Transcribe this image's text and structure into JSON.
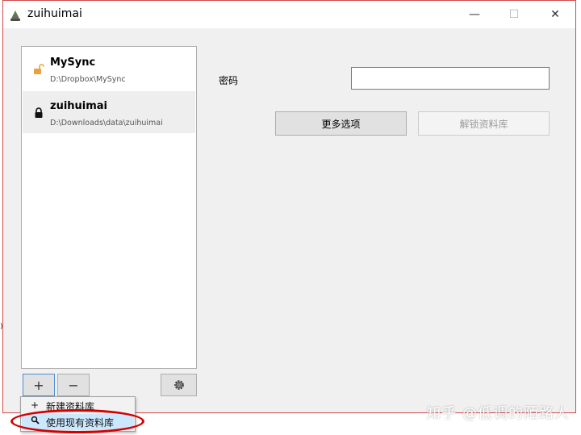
{
  "window": {
    "title": "zuihuimai",
    "minimize": "—",
    "maximize": "☐",
    "close": "✕"
  },
  "vaults": [
    {
      "name": "MySync",
      "path": "D:\\Dropbox\\MySync",
      "locked": false
    },
    {
      "name": "zuihuimai",
      "path": "D:\\Downloads\\data\\zuihuimai",
      "locked": true
    }
  ],
  "toolbar": {
    "add": "+",
    "remove": "−",
    "settings_icon": "gear-icon"
  },
  "form": {
    "password_label": "密码",
    "password_value": "",
    "more_options": "更多选项",
    "unlock": "解锁资料库"
  },
  "add_menu": [
    {
      "icon": "+",
      "label": "新建资料库"
    },
    {
      "icon": "🔍",
      "label": "使用现有资料库"
    }
  ],
  "watermark": "知乎 @低调的陌路人",
  "colors": {
    "highlight": "#cce8ff",
    "annotation": "#d40000",
    "lock_open": "#e8a23c"
  }
}
